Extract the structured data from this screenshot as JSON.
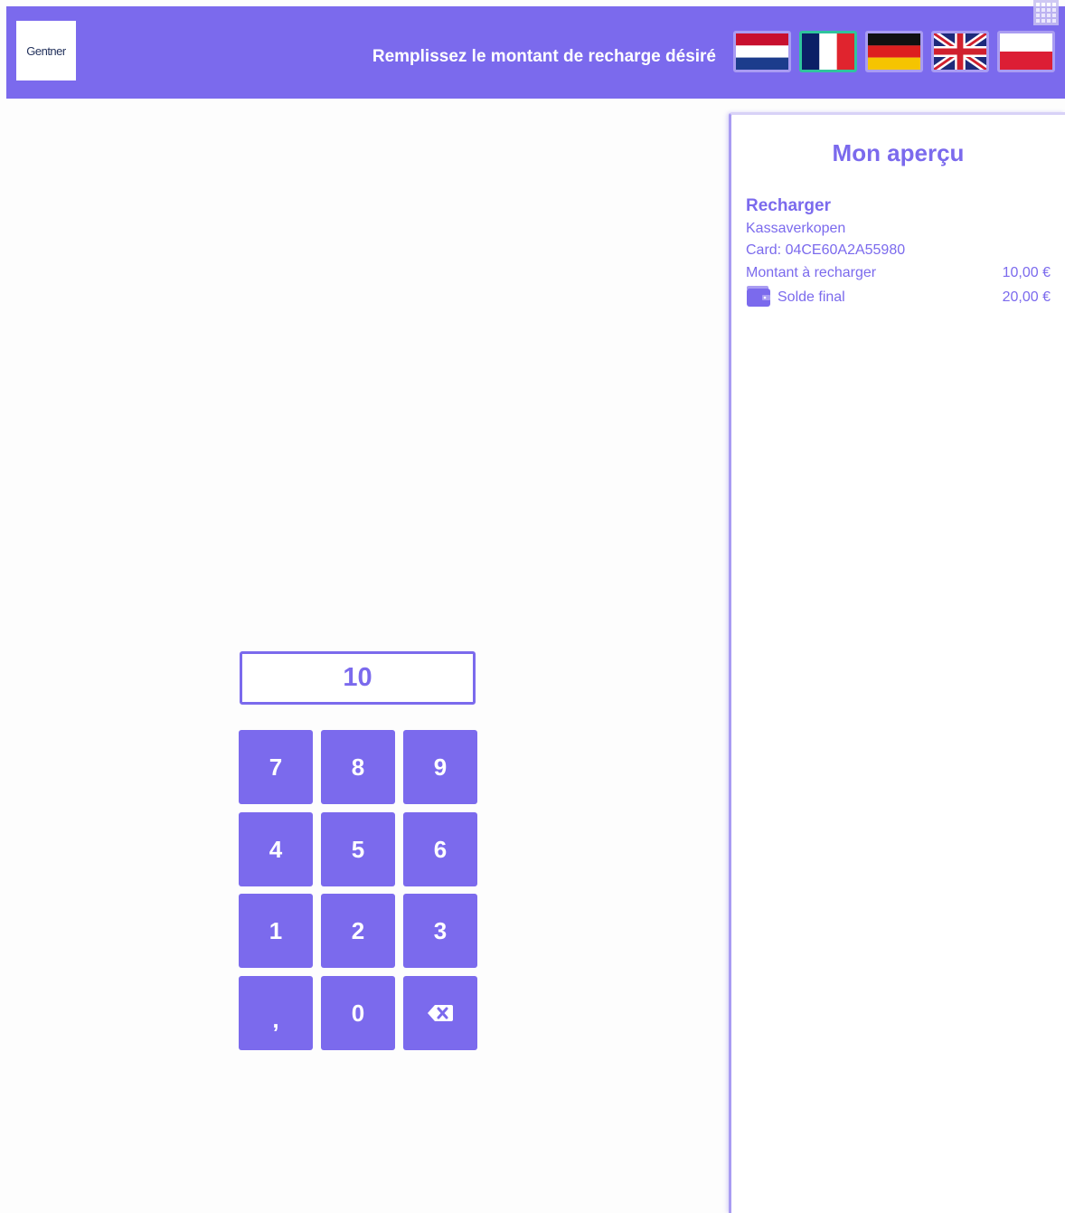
{
  "header": {
    "logo_text": "Gentner",
    "title": "Remplissez le montant de recharge désiré",
    "languages": [
      {
        "icon": "dutch-flag-icon",
        "code": "NL",
        "selected": false
      },
      {
        "icon": "french-flag-icon",
        "code": "FR",
        "selected": true
      },
      {
        "icon": "german-flag-icon",
        "code": "DE",
        "selected": false
      },
      {
        "icon": "uk-flag-icon",
        "code": "EN",
        "selected": false
      },
      {
        "icon": "polish-flag-icon",
        "code": "PL",
        "selected": false
      }
    ],
    "corner_icon": "grid-icon"
  },
  "amount_input": {
    "value": "10"
  },
  "keypad": {
    "keys": [
      "7",
      "8",
      "9",
      "4",
      "5",
      "6",
      "1",
      "2",
      "3",
      ",",
      "0"
    ],
    "backspace_icon": "backspace-icon"
  },
  "overview": {
    "title": "Mon aperçu",
    "section_title": "Recharger",
    "line1": "Kassaverkopen",
    "card": "Card: 04CE60A2A55980",
    "amount_label": "Montant à recharger",
    "amount_value": "10,00 €",
    "balance_icon": "wallet-icon",
    "balance_label": "Solde final",
    "balance_value": "20,00 €"
  },
  "colors": {
    "accent": "#7b6aed",
    "selected_flag_border": "#2fc49d",
    "background": "#fdfdfd"
  }
}
